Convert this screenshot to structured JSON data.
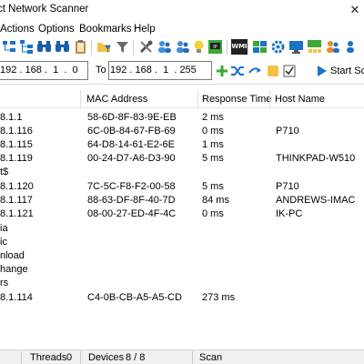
{
  "window": {
    "title": "ct Network Scanner",
    "close_glyph": "✕"
  },
  "menu": [
    "Actions",
    "Options",
    "Bookmarks",
    "Help"
  ],
  "toolbar": {
    "icons": [
      "tree-collapse-icon",
      "tree-expand-icon",
      "binoculars-icon",
      "clipboard-icon",
      "folder-filter-icon",
      "filter-icon",
      "tools-icon",
      "people-icon",
      "bulb-icon",
      "network-ip-icon",
      "wmi-icon",
      "puzzle-icon",
      "gear-icon",
      "monitor-icon",
      "network-icon",
      "users-icon"
    ],
    "wmi_label": "WMI"
  },
  "range": {
    "from_ip": "192 . 168 .  1  .  0",
    "to_label": "To",
    "to_ip": "192 . 168 .  1  . 255",
    "start_label": "Start Scan"
  },
  "columns": {
    "mac": "MAC Address",
    "response": "Response Time",
    "host": "Host Name"
  },
  "rows": [
    {
      "ip": "8.1.1",
      "mac": "58-6D-8F-83-9E-EB",
      "time": "2 ms",
      "host": ""
    },
    {
      "ip": "8.1.116",
      "mac": "6C-0B-84-67-FB-69",
      "time": "0 ms",
      "host": "P710"
    },
    {
      "ip": "8.1.115",
      "mac": "64-D8-14-61-E2-6E",
      "time": "1 ms",
      "host": ""
    },
    {
      "ip": "8.1.119",
      "mac": "00-24-D7-A6-D3-90",
      "time": "5 ms",
      "host": "THINKPAD-W510"
    },
    {
      "ip": "t$",
      "mac": "",
      "time": "",
      "host": ""
    },
    {
      "ip": "8.1.120",
      "mac": "7C-5C-F8-F2-00-58",
      "time": "5 ms",
      "host": "P710"
    },
    {
      "ip": "8.1.117",
      "mac": "88-63-DF-8F-40-7D",
      "time": "84 ms",
      "host": "ANDREWS-IMAC"
    },
    {
      "ip": "8.1.121",
      "mac": "08-00-27-ED-4F-4C",
      "time": "0 ms",
      "host": "IK-PC"
    },
    {
      "ip": "ia",
      "mac": "",
      "time": "",
      "host": ""
    },
    {
      "ip": "ic",
      "mac": "",
      "time": "",
      "host": ""
    },
    {
      "ip": "nload",
      "mac": "",
      "time": "",
      "host": ""
    },
    {
      "ip": "hange",
      "mac": "",
      "time": "",
      "host": ""
    },
    {
      "ip": "rs",
      "mac": "",
      "time": "",
      "host": ""
    },
    {
      "ip": "8.1.114",
      "mac": "C4-0B-CB-A5-A5-CD",
      "time": "273 ms",
      "host": ""
    }
  ],
  "status": {
    "threads_label": "Threads",
    "threads_value": "0",
    "devices_label": "Devices",
    "devices_value": "8 / 8",
    "scan_label": "Scan"
  },
  "colors": {
    "accent_blue": "#1a73c9",
    "green": "#3aaa35",
    "folder_yellow": "#f3c242"
  }
}
